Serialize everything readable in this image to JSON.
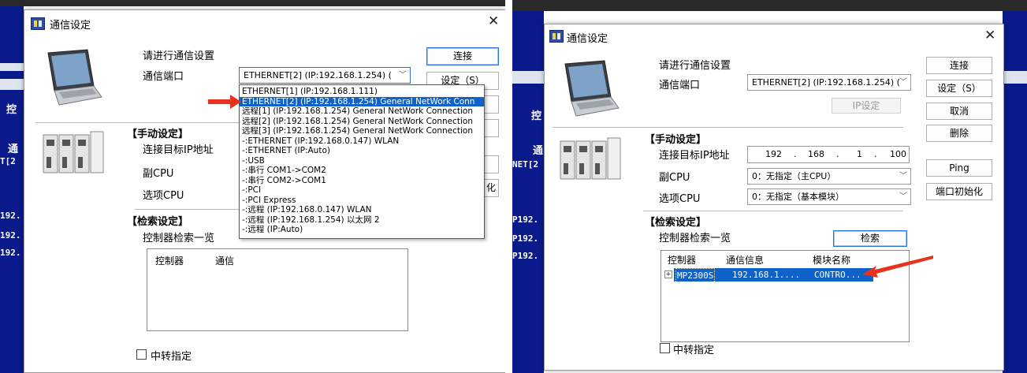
{
  "dialog_title": "通信设定",
  "close_glyph": "✕",
  "prompt": "请进行通信设置",
  "port_label": "通信端口",
  "port_value": "ETHERNET[2]  (IP:192.168.1.254) (",
  "buttons": {
    "connect": "连接",
    "settings": "设定（S）",
    "settings_right": "设定（S）",
    "cancel": "取消",
    "delete": "删除",
    "ip_settings": "IP设定",
    "ping": "Ping",
    "port_init": "端口初始化",
    "search": "检索"
  },
  "manual_section": "【手动设定】",
  "target_ip_label": "连接目标IP地址",
  "sub_cpu_label": "副CPU",
  "option_cpu_label": "选项CPU",
  "ip_octets": [
    "192",
    "168",
    "1",
    "100"
  ],
  "sub_cpu_value": "0：无指定（主CPU）",
  "option_cpu_value": "0：无指定（基本模块）",
  "search_section": "【检索设定】",
  "search_list_label": "控制器检索一览",
  "list_headers": [
    "控制器",
    "通信信息",
    "模块名称"
  ],
  "list_rows": [
    {
      "expand": "+",
      "controller": "MP2300S",
      "comm": "192.168.1....",
      "module": "CONTRO..."
    }
  ],
  "relay_label": "中转指定",
  "port_options": [
    "ETHERNET[1]  (IP:192.168.1.111)",
    "ETHERNET[2]  (IP:192.168.1.254) General NetWork Conn",
    "远程[1]  (IP:192.168.1.254) General NetWork Connection",
    "远程[2]  (IP:192.168.1.254) General NetWork Connection",
    "远程[3]  (IP:192.168.1.254) General NetWork Connection",
    "-:ETHERNET  (IP:192.168.0.147) WLAN",
    "-:ETHERNET  (IP:Auto)",
    "-:USB",
    "-:串行  COM1->COM2",
    "-:串行  COM2->COM1",
    "-:PCI",
    "-:PCI Express",
    "-:远程  (IP:192.168.0.147) WLAN",
    "-:远程  (IP:192.168.1.254) 以太网 2",
    "-:远程  (IP:Auto)"
  ],
  "selected_port_index": 1,
  "left_partial_header": "通信",
  "bg_left": [
    "控",
    "通",
    "T[2",
    "192.",
    "192.",
    "192."
  ],
  "bg_right": [
    "控",
    "通",
    "NET[2",
    "P192.",
    "P192.",
    "P192."
  ],
  "colors": {
    "accent": "#0f62c8",
    "bg_app": "#0a1a8a",
    "arrow": "#e8321e"
  }
}
